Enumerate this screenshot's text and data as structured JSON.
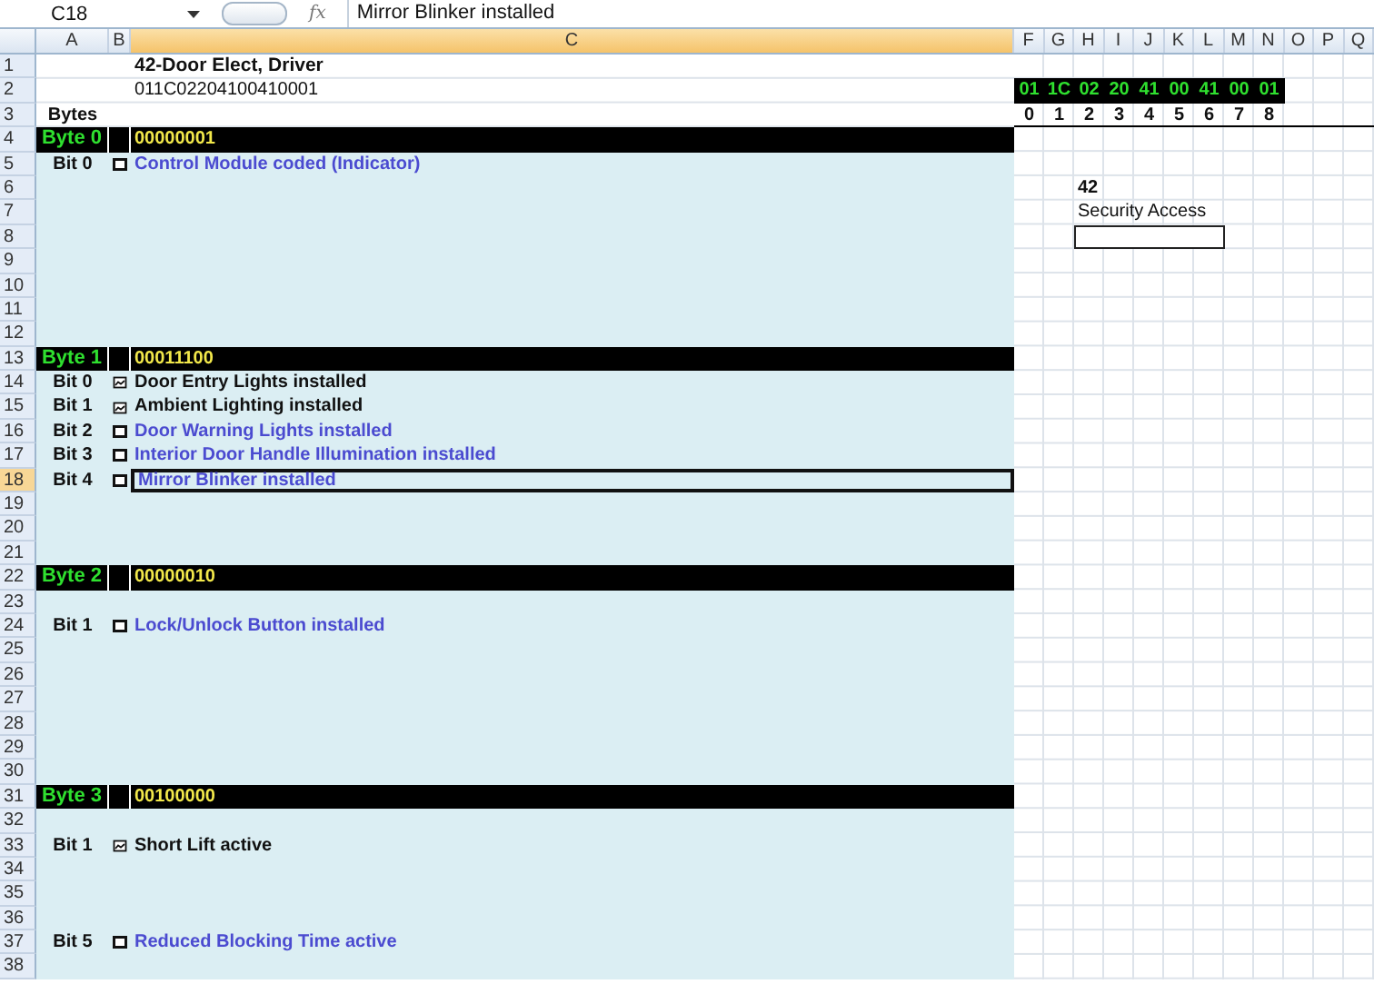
{
  "name_box": "C18",
  "function_symbol": "fx",
  "formula": "Mirror Blinker installed",
  "columns": [
    {
      "label": "A",
      "selected": false
    },
    {
      "label": "B",
      "selected": false
    },
    {
      "label": "C",
      "selected": true
    },
    {
      "label": "F",
      "selected": false
    },
    {
      "label": "G",
      "selected": false
    },
    {
      "label": "H",
      "selected": false
    },
    {
      "label": "I",
      "selected": false
    },
    {
      "label": "J",
      "selected": false
    },
    {
      "label": "K",
      "selected": false
    },
    {
      "label": "L",
      "selected": false
    },
    {
      "label": "M",
      "selected": false
    },
    {
      "label": "N",
      "selected": false
    },
    {
      "label": "O",
      "selected": false
    },
    {
      "label": "P",
      "selected": false
    },
    {
      "label": "Q",
      "selected": false
    }
  ],
  "rows": [
    {
      "number": "1",
      "selected": false,
      "kind": "title",
      "text": "42-Door Elect, Driver"
    },
    {
      "number": "2",
      "selected": false,
      "kind": "text",
      "text": "011C02204100410001",
      "hex": [
        "01",
        "1C",
        "02",
        "20",
        "41",
        "00",
        "41",
        "00",
        "01"
      ]
    },
    {
      "number": "3",
      "selected": false,
      "kind": "label",
      "label": "Bytes",
      "indices": [
        "0",
        "1",
        "2",
        "3",
        "4",
        "5",
        "6",
        "7",
        "8"
      ]
    },
    {
      "number": "4",
      "selected": false,
      "kind": "byte",
      "label": "Byte 0",
      "text": "00000001"
    },
    {
      "number": "5",
      "selected": false,
      "kind": "bit",
      "label": "Bit 0",
      "checked": false,
      "text": "Control Module coded (Indicator)"
    },
    {
      "number": "6",
      "selected": false,
      "kind": "blank",
      "right_text": "42"
    },
    {
      "number": "7",
      "selected": false,
      "kind": "blank",
      "right_text": "Security Access"
    },
    {
      "number": "8",
      "selected": false,
      "kind": "blank",
      "input_box": true
    },
    {
      "number": "9",
      "selected": false,
      "kind": "blank"
    },
    {
      "number": "10",
      "selected": false,
      "kind": "blank"
    },
    {
      "number": "11",
      "selected": false,
      "kind": "blank"
    },
    {
      "number": "12",
      "selected": false,
      "kind": "blank"
    },
    {
      "number": "13",
      "selected": false,
      "kind": "byte",
      "label": "Byte 1",
      "text": "00011100"
    },
    {
      "number": "14",
      "selected": false,
      "kind": "bit",
      "label": "Bit 0",
      "checked": true,
      "text": "Door Entry Lights installed"
    },
    {
      "number": "15",
      "selected": false,
      "kind": "bit",
      "label": "Bit 1",
      "checked": true,
      "text": "Ambient Lighting installed"
    },
    {
      "number": "16",
      "selected": false,
      "kind": "bit",
      "label": "Bit 2",
      "checked": false,
      "text": "Door Warning Lights installed"
    },
    {
      "number": "17",
      "selected": false,
      "kind": "bit",
      "label": "Bit 3",
      "checked": false,
      "text": "Interior Door Handle Illumination installed"
    },
    {
      "number": "18",
      "selected": true,
      "kind": "bit",
      "label": "Bit 4",
      "checked": false,
      "text": "Mirror Blinker installed"
    },
    {
      "number": "19",
      "selected": false,
      "kind": "blank"
    },
    {
      "number": "20",
      "selected": false,
      "kind": "blank"
    },
    {
      "number": "21",
      "selected": false,
      "kind": "blank"
    },
    {
      "number": "22",
      "selected": false,
      "kind": "byte",
      "label": "Byte 2",
      "text": "00000010"
    },
    {
      "number": "23",
      "selected": false,
      "kind": "blank"
    },
    {
      "number": "24",
      "selected": false,
      "kind": "bit",
      "label": "Bit 1",
      "checked": false,
      "text": "Lock/Unlock Button installed"
    },
    {
      "number": "25",
      "selected": false,
      "kind": "blank"
    },
    {
      "number": "26",
      "selected": false,
      "kind": "blank"
    },
    {
      "number": "27",
      "selected": false,
      "kind": "blank"
    },
    {
      "number": "28",
      "selected": false,
      "kind": "blank"
    },
    {
      "number": "29",
      "selected": false,
      "kind": "blank"
    },
    {
      "number": "30",
      "selected": false,
      "kind": "blank"
    },
    {
      "number": "31",
      "selected": false,
      "kind": "byte",
      "label": "Byte 3",
      "text": "00100000"
    },
    {
      "number": "32",
      "selected": false,
      "kind": "blank"
    },
    {
      "number": "33",
      "selected": false,
      "kind": "bit",
      "label": "Bit 1",
      "checked": true,
      "text": "Short Lift active"
    },
    {
      "number": "34",
      "selected": false,
      "kind": "blank"
    },
    {
      "number": "35",
      "selected": false,
      "kind": "blank"
    },
    {
      "number": "36",
      "selected": false,
      "kind": "blank"
    },
    {
      "number": "37",
      "selected": false,
      "kind": "bit",
      "label": "Bit 5",
      "checked": false,
      "text": "Reduced Blocking Time active"
    },
    {
      "number": "38",
      "selected": false,
      "kind": "blank"
    }
  ]
}
